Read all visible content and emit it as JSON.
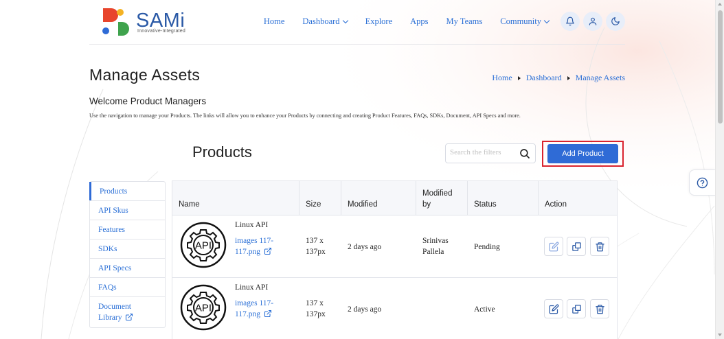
{
  "logo": {
    "name": "SAMi",
    "tagline": "Innovative-Integrated"
  },
  "nav": {
    "items": [
      {
        "label": "Home"
      },
      {
        "label": "Dashboard"
      },
      {
        "label": "Explore"
      },
      {
        "label": "Apps"
      },
      {
        "label": "My Teams"
      },
      {
        "label": "Community"
      }
    ],
    "icons": [
      "bell-icon",
      "user-icon",
      "moon-icon"
    ]
  },
  "page": {
    "title": "Manage Assets",
    "breadcrumb": [
      "Home",
      "Dashboard",
      "Manage Assets"
    ],
    "welcome": "Welcome Product Managers",
    "description": "Use the navigation to manage your Products. The links will allow you to enhance your Products by connecting and creating Product Features, FAQs, SDKs, Document, API Specs and more."
  },
  "products": {
    "title": "Products",
    "search_placeholder": "Search the filters",
    "add_button": "Add Product"
  },
  "sidebar": {
    "items": [
      {
        "label": "Products",
        "active": true
      },
      {
        "label": "API Skus"
      },
      {
        "label": "Features"
      },
      {
        "label": "SDKs"
      },
      {
        "label": "API Specs"
      },
      {
        "label": "FAQs"
      },
      {
        "label": "Document Library"
      }
    ]
  },
  "table": {
    "headers": {
      "name": "Name",
      "size": "Size",
      "modified": "Modified",
      "modified_by": "Modified by",
      "status": "Status",
      "action": "Action"
    },
    "rows": [
      {
        "name": "Linux API",
        "file": "images 117-117.png",
        "size": "137 x 137px",
        "modified": "2 days ago",
        "modified_by": "Srinivas Pallela",
        "status": "Pending",
        "icon": "api-gear-icon"
      },
      {
        "name": "Linux API",
        "file": "images 117-117.png",
        "size": "137 x 137px",
        "modified": "2 days ago",
        "modified_by": "",
        "status": "Active",
        "icon": "api-gear-icon"
      }
    ]
  },
  "colors": {
    "primary": "#2f6bd6",
    "link": "#2a6fd6",
    "highlight_outline": "#d9232e"
  }
}
